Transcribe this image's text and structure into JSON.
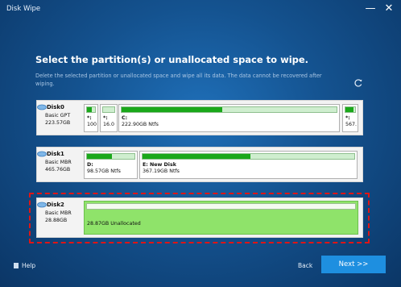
{
  "window": {
    "title": "Disk Wipe",
    "minimize_label": "—",
    "close_label": "✕"
  },
  "heading": "Select the partition(s) or unallocated space to wipe.",
  "description": "Delete the selected partition or unallocated space and wipe all its data. The data cannot be recovered after wiping.",
  "refresh_icon": "refresh-icon",
  "disks": [
    {
      "name": "Disk0",
      "type": "Basic GPT",
      "size": "223.57GB",
      "partitions": [
        {
          "name": "*:",
          "info": "100",
          "used_fraction": 0.6
        },
        {
          "name": "*:",
          "info": "16.0",
          "used_fraction": 0.0
        },
        {
          "name": "C:",
          "info": "222.90GB Ntfs",
          "used_fraction": 0.47
        },
        {
          "name": "*:",
          "info": "567.",
          "used_fraction": 0.8
        }
      ]
    },
    {
      "name": "Disk1",
      "type": "Basic MBR",
      "size": "465.76GB",
      "partitions": [
        {
          "name": "D:",
          "info": "98.57GB Ntfs",
          "used_fraction": 0.52
        },
        {
          "name": "E: New Disk",
          "info": "367.19GB Ntfs",
          "used_fraction": 0.51
        }
      ]
    },
    {
      "name": "Disk2",
      "type": "Basic MBR",
      "size": "28.88GB",
      "partitions": [
        {
          "name": "",
          "info": "28.87GB Unallocated",
          "used_fraction": 0.0,
          "unallocated": true,
          "selected": true
        }
      ]
    }
  ],
  "footer": {
    "help_label": "Help",
    "back_label": "Back",
    "next_label": "Next >>"
  },
  "colors": {
    "accent": "#1e8fe0",
    "used_bar": "#1aa81a",
    "unallocated": "#8fe36a",
    "selection_border": "#e01515"
  }
}
